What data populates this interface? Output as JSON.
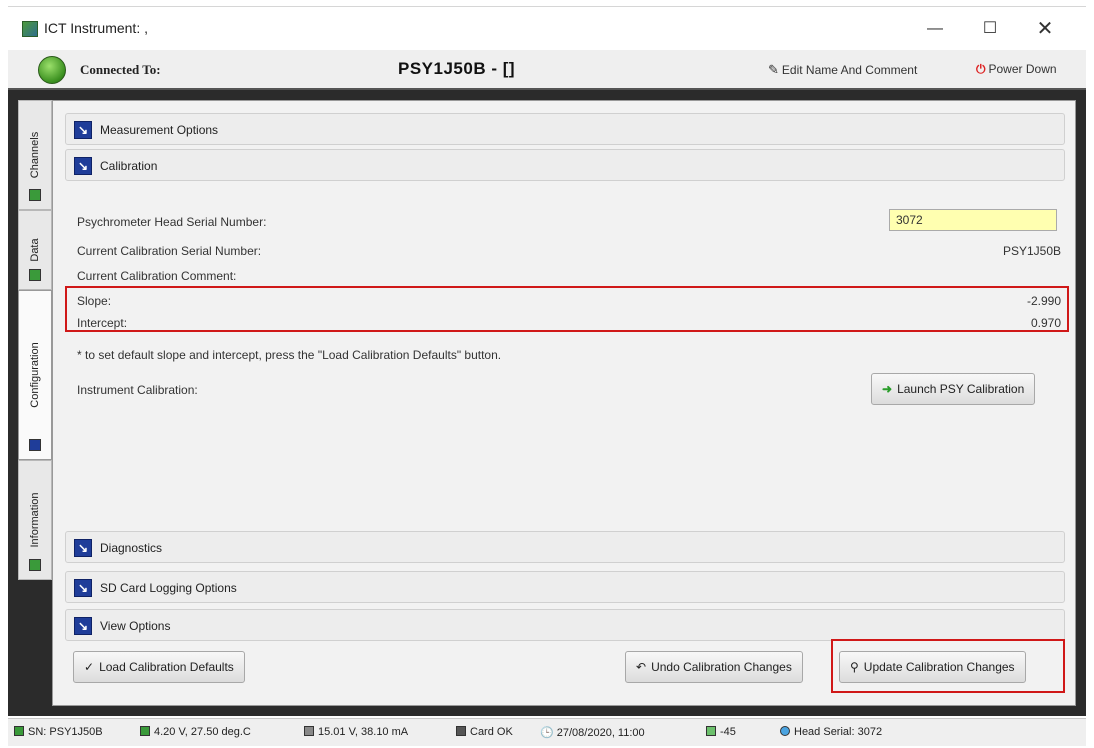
{
  "window": {
    "title": "ICT Instrument: ,",
    "min_glyph": "—",
    "max_glyph": "☐",
    "close_glyph": "✕"
  },
  "header": {
    "connected_label": "Connected To:",
    "device_name": "PSY1J50B - []",
    "edit_label": "Edit Name And Comment",
    "power_label": "Power Down"
  },
  "side_tabs": [
    {
      "label": "Channels"
    },
    {
      "label": "Data"
    },
    {
      "label": "Configuration"
    },
    {
      "label": "Information"
    }
  ],
  "sections": {
    "measurement_options": "Measurement Options",
    "calibration": "Calibration",
    "diagnostics": "Diagnostics",
    "sd_card": "SD Card Logging Options",
    "view_options": "View Options"
  },
  "calibration": {
    "head_serial_label": "Psychrometer Head Serial Number:",
    "head_serial_value": "3072",
    "cal_serial_label": "Current Calibration Serial Number:",
    "cal_serial_value": "PSY1J50B",
    "cal_comment_label": "Current Calibration Comment:",
    "slope_label": "Slope:",
    "slope_value": "-2.990",
    "intercept_label": "Intercept:",
    "intercept_value": "0.970",
    "note": "* to set default slope and intercept, press the \"Load Calibration Defaults\" button.",
    "instrument_cal_label": "Instrument Calibration:",
    "launch_button": "Launch PSY Calibration"
  },
  "buttons": {
    "load_defaults": "Load Calibration Defaults",
    "undo": "Undo Calibration Changes",
    "update": "Update Calibration Changes"
  },
  "statusbar": {
    "sn": "SN: PSY1J50B",
    "battery": "4.20 V, 27.50 deg.C",
    "power": "15.01 V, 38.10 mA",
    "card": "Card OK",
    "datetime": "27/08/2020, 11:00",
    "signal": "-45",
    "head_serial": "Head Serial: 3072"
  }
}
